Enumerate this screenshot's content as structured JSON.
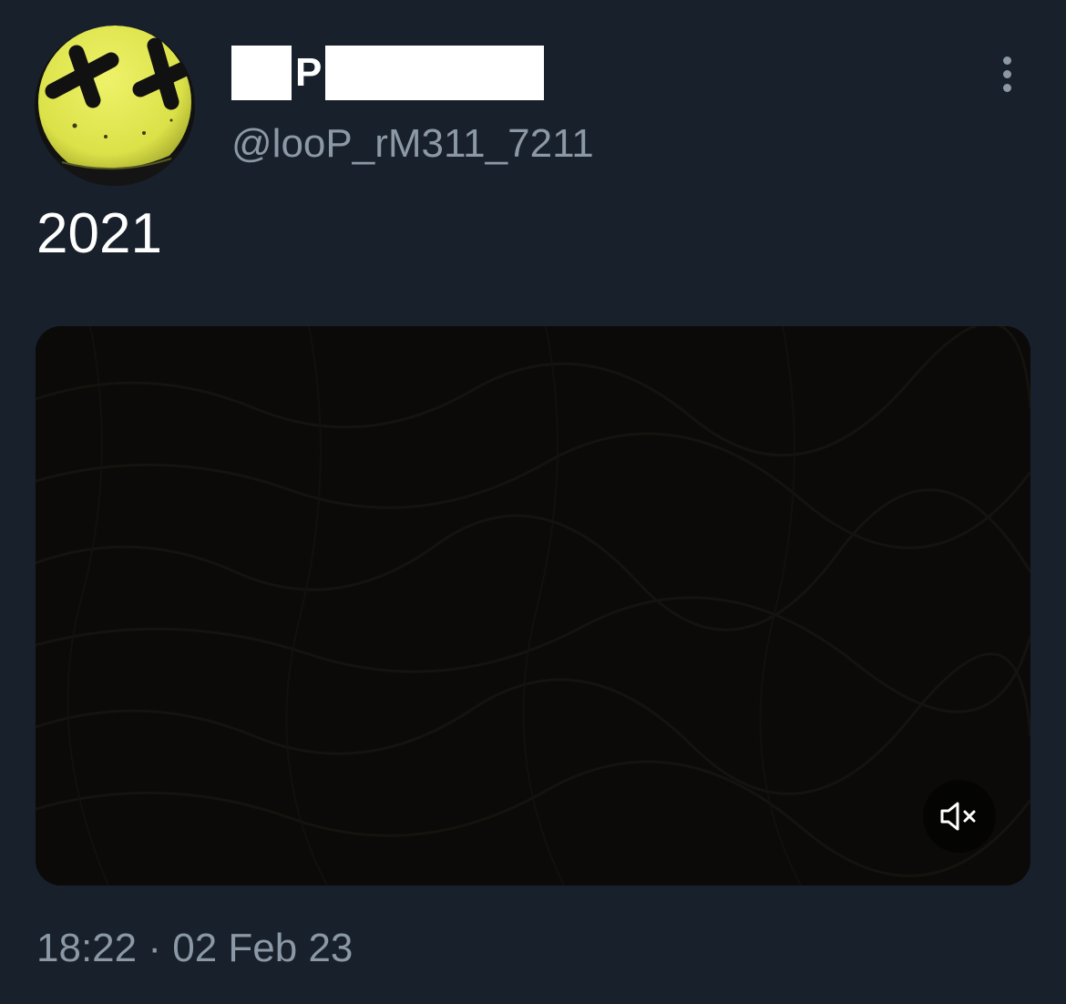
{
  "tweet": {
    "author": {
      "display_name_visible_letter": "P",
      "handle": "@looP_rM311_7211",
      "avatar": "yellow-smiley-x-eyes-avatar"
    },
    "text": "2021",
    "media": {
      "type": "video",
      "muted": true,
      "mute_icon": "speaker-muted-icon"
    },
    "time": "18:22",
    "separator": "·",
    "date": "02 Feb 23"
  },
  "icons": {
    "more": "more-vertical-icon"
  },
  "colors": {
    "background": "#18202b",
    "text_primary": "#ffffff",
    "text_secondary": "#8b98a5",
    "avatar_yellow": "#e3e94e",
    "media_background": "#0b0a08"
  }
}
